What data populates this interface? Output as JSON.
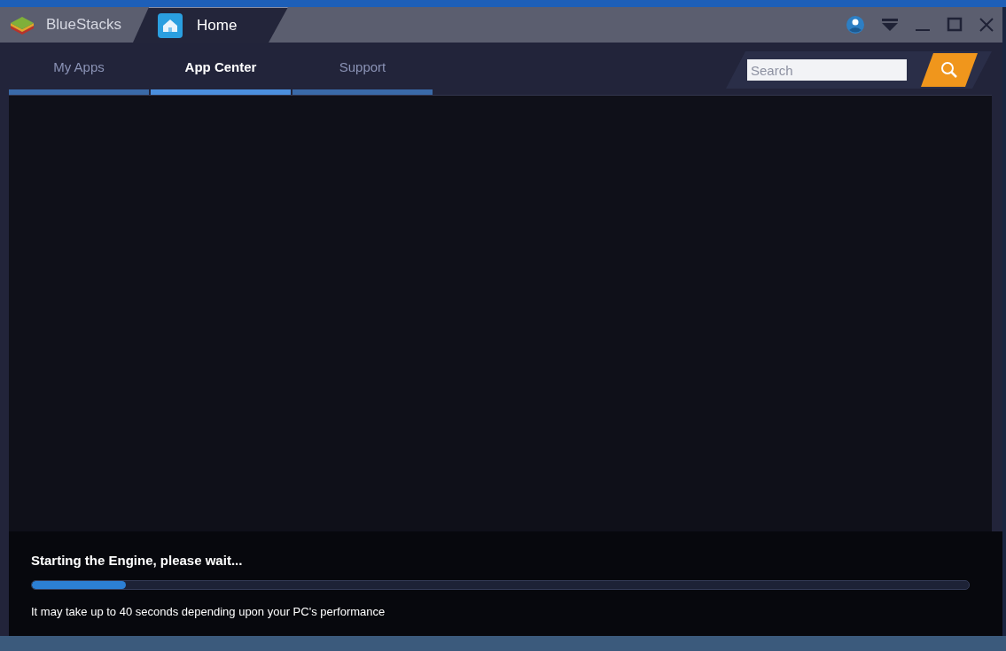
{
  "window": {
    "app_name": "BlueStacks",
    "tab_title": "Home"
  },
  "tabs": [
    {
      "label": "My Apps",
      "selected": false
    },
    {
      "label": "App Center",
      "selected": true
    },
    {
      "label": "Support",
      "selected": false
    }
  ],
  "search": {
    "placeholder": "Search"
  },
  "loading": {
    "title": "Starting the Engine, please wait...",
    "level": 0.1,
    "note": "It may take up to 40 seconds depending upon your PC's performance"
  }
}
